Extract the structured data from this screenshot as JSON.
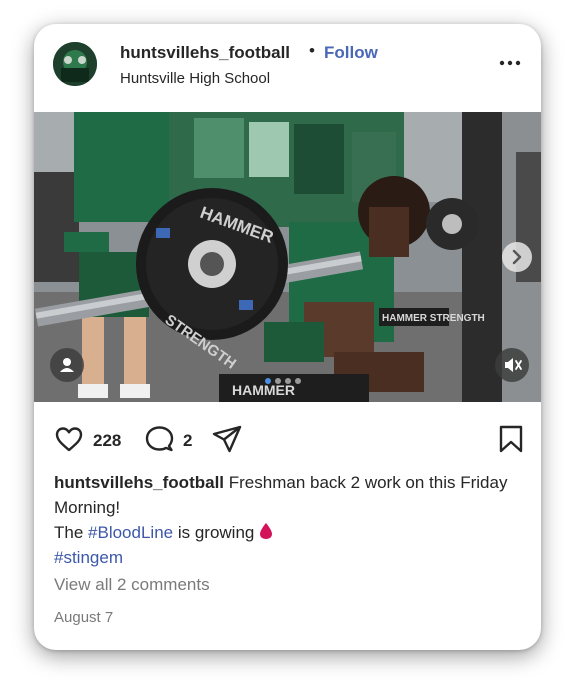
{
  "header": {
    "username": "huntsvillehs_football",
    "separator": "•",
    "follow_label": "Follow",
    "location": "Huntsville High School"
  },
  "media": {
    "carousel": {
      "count": 4,
      "active_index": 0
    },
    "icons": [
      "user-tag-icon",
      "mute-icon",
      "next-arrow-icon"
    ]
  },
  "actions": {
    "likes": "228",
    "comments": "2"
  },
  "caption": {
    "username": "huntsvillehs_football",
    "line1": " Freshman back 2 work on this Friday Morning!",
    "line2_prefix": "The ",
    "hashtag1": "#BloodLine",
    "line2_suffix": " is growing ",
    "emoji": "blood-drop",
    "hashtag2": "#stingem"
  },
  "view_comments": "View all 2 comments",
  "date": "August 7",
  "colors": {
    "link_blue": "#4a67b8",
    "hashtag_blue": "#3d58a8",
    "muted_gray": "#7a7a7a",
    "text": "#262626",
    "blood_red": "#d4145a",
    "team_green": "#1f6b45"
  }
}
